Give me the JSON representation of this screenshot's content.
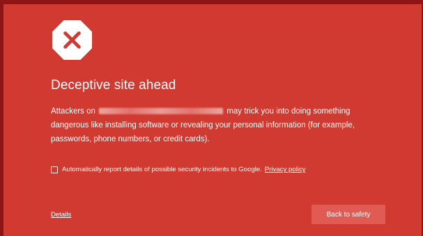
{
  "warning": {
    "icon": "error-x-octagon-icon",
    "title": "Deceptive site ahead",
    "body_prefix": "Attackers on",
    "body_suffix": "may trick you into doing something dangerous like installing software or revealing your personal information (for example, passwords, phone numbers, or credit cards).",
    "report_label": "Automatically report details of possible security incidents to Google.",
    "privacy_link": "Privacy policy",
    "details_link": "Details",
    "back_button": "Back to safety"
  },
  "colors": {
    "frame": "#8f1414",
    "background": "#d13a31",
    "button": "#e05b53",
    "icon_x": "#d13a31",
    "text": "#ffffff"
  }
}
